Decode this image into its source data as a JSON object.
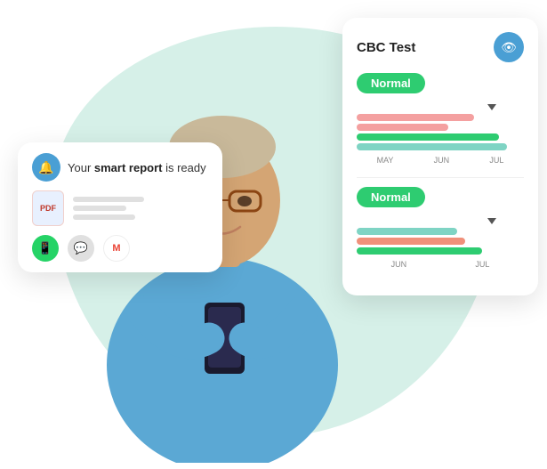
{
  "background": {
    "blob_color": "#d6f0e8"
  },
  "notification_card": {
    "bell_icon": "🔔",
    "text_prefix": "Your ",
    "text_bold": "smart report",
    "text_suffix": " is ready",
    "pdf_label": "PDF",
    "share_icons": [
      {
        "name": "whatsapp",
        "symbol": "W",
        "label": "WhatsApp"
      },
      {
        "name": "sms",
        "symbol": "💬",
        "label": "SMS"
      },
      {
        "name": "gmail",
        "symbol": "M",
        "label": "Gmail"
      }
    ]
  },
  "cbc_card": {
    "title": "CBC Test",
    "eye_icon": "👁",
    "normal_badge_1": "Normal",
    "normal_badge_2": "Normal",
    "chart_months_1": [
      "MAY",
      "JUN",
      "JUL"
    ],
    "chart_months_2": [
      "JUN",
      "JUL"
    ]
  }
}
